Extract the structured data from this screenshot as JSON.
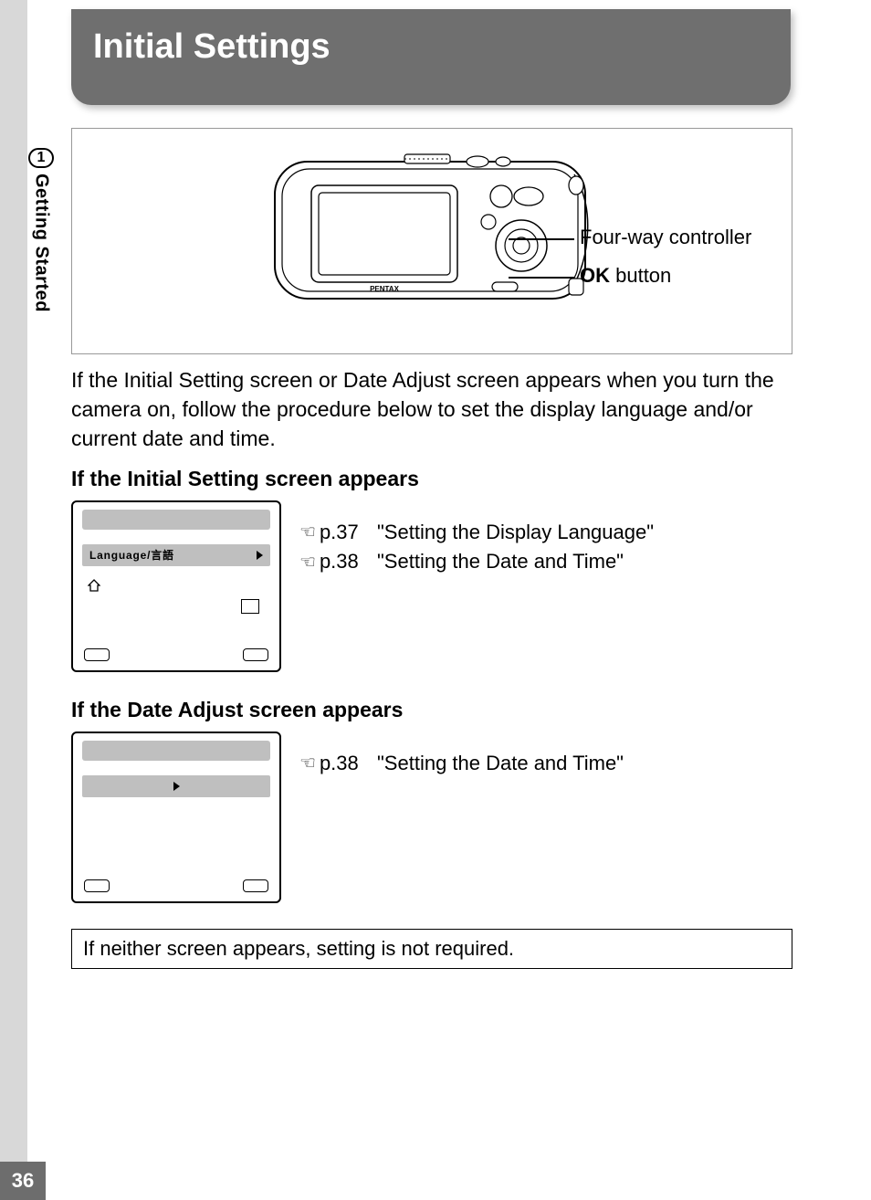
{
  "page": {
    "number": "36",
    "tab_number": "1",
    "tab_label": "Getting Started",
    "title": "Initial Settings"
  },
  "diagram": {
    "callout1": "Four-way controller",
    "callout2_bold": "OK",
    "callout2_rest": " button",
    "brand": "PENTAX"
  },
  "intro": "If the Initial Setting screen or Date Adjust screen appears when you turn the camera on, follow the procedure below to set the display language and/or current date and time.",
  "section1": {
    "heading": "If the Initial Setting screen appears",
    "screen_label": "Language/言語",
    "refs": [
      {
        "page": "p.37",
        "title": "\"Setting the Display Language\""
      },
      {
        "page": "p.38",
        "title": "\"Setting the Date and Time\""
      }
    ]
  },
  "section2": {
    "heading": "If the Date Adjust screen appears",
    "refs": [
      {
        "page": "p.38",
        "title": "\"Setting the Date and Time\""
      }
    ]
  },
  "note": "If neither screen appears, setting is not required."
}
